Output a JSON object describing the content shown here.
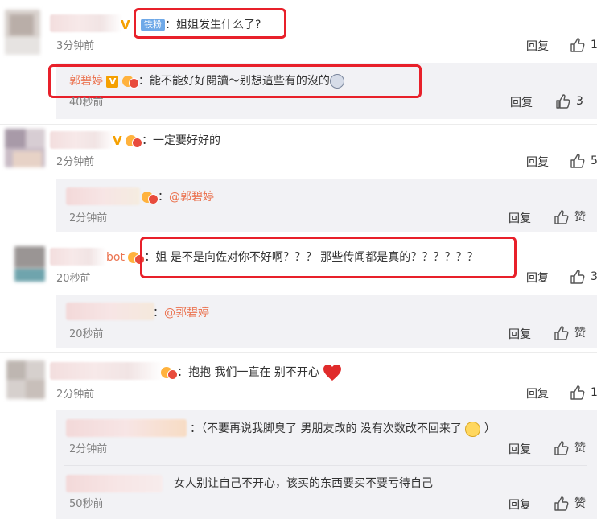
{
  "comments": [
    {
      "id": "c1",
      "badge": "铁粉",
      "text": "：姐姐发生什么了?",
      "time": "3分钟前",
      "reply": "回复",
      "like_icon": "thumbs-up-icon",
      "like_count": "1",
      "highlighted": true
    },
    {
      "id": "c1r1",
      "author": "郭碧婷",
      "text": "：能不能好好閱讀～别想這些有的沒的",
      "time": "40秒前",
      "reply": "回复",
      "like_icon": "thumbs-up-icon",
      "like_count": "3",
      "highlighted": true
    },
    {
      "id": "c2",
      "text": "：一定要好好的",
      "time": "2分钟前",
      "reply": "回复",
      "like_icon": "thumbs-up-icon",
      "like_count": "5"
    },
    {
      "id": "c2r1",
      "mention": "@郭碧婷",
      "prefix": "：",
      "time": "2分钟前",
      "reply": "回复",
      "like_icon": "thumbs-up-icon",
      "like_label": "赞"
    },
    {
      "id": "c3",
      "name_visible": "bot",
      "text": "：姐 是不是向佐对你不好啊？？？ 那些传闻都是真的？？？？？？",
      "time": "20秒前",
      "reply": "回复",
      "like_icon": "thumbs-up-icon",
      "like_count": "3",
      "highlighted": true
    },
    {
      "id": "c3r1",
      "mention": "@郭碧婷",
      "prefix": "：",
      "time": "20秒前",
      "reply": "回复",
      "like_icon": "thumbs-up-icon",
      "like_label": "赞"
    },
    {
      "id": "c4",
      "text": "：抱抱 我们一直在 别不开心",
      "time": "2分钟前",
      "reply": "回复",
      "like_icon": "thumbs-up-icon",
      "like_count": "1"
    },
    {
      "id": "c4r1",
      "text": "：（不要再说我脚臭了 男朋友改的 没有次数改不回来了",
      "time": "2分钟前",
      "reply": "回复",
      "like_icon": "thumbs-up-icon",
      "like_label": "赞"
    },
    {
      "id": "c4r2",
      "text": "女人别让自己不开心，该买的东西要买不要亏待自己",
      "time": "50秒前",
      "reply": "回复",
      "like_icon": "thumbs-up-icon",
      "like_label": "赞"
    }
  ],
  "colors": {
    "highlight_border": "#e8202a",
    "author_link": "#eb7350",
    "sub_background": "#f2f2f5",
    "time_gray": "#808080",
    "verified_v": "#f5a000",
    "fan_badge": "#6fa9e8",
    "heart": "#e02b2b"
  }
}
